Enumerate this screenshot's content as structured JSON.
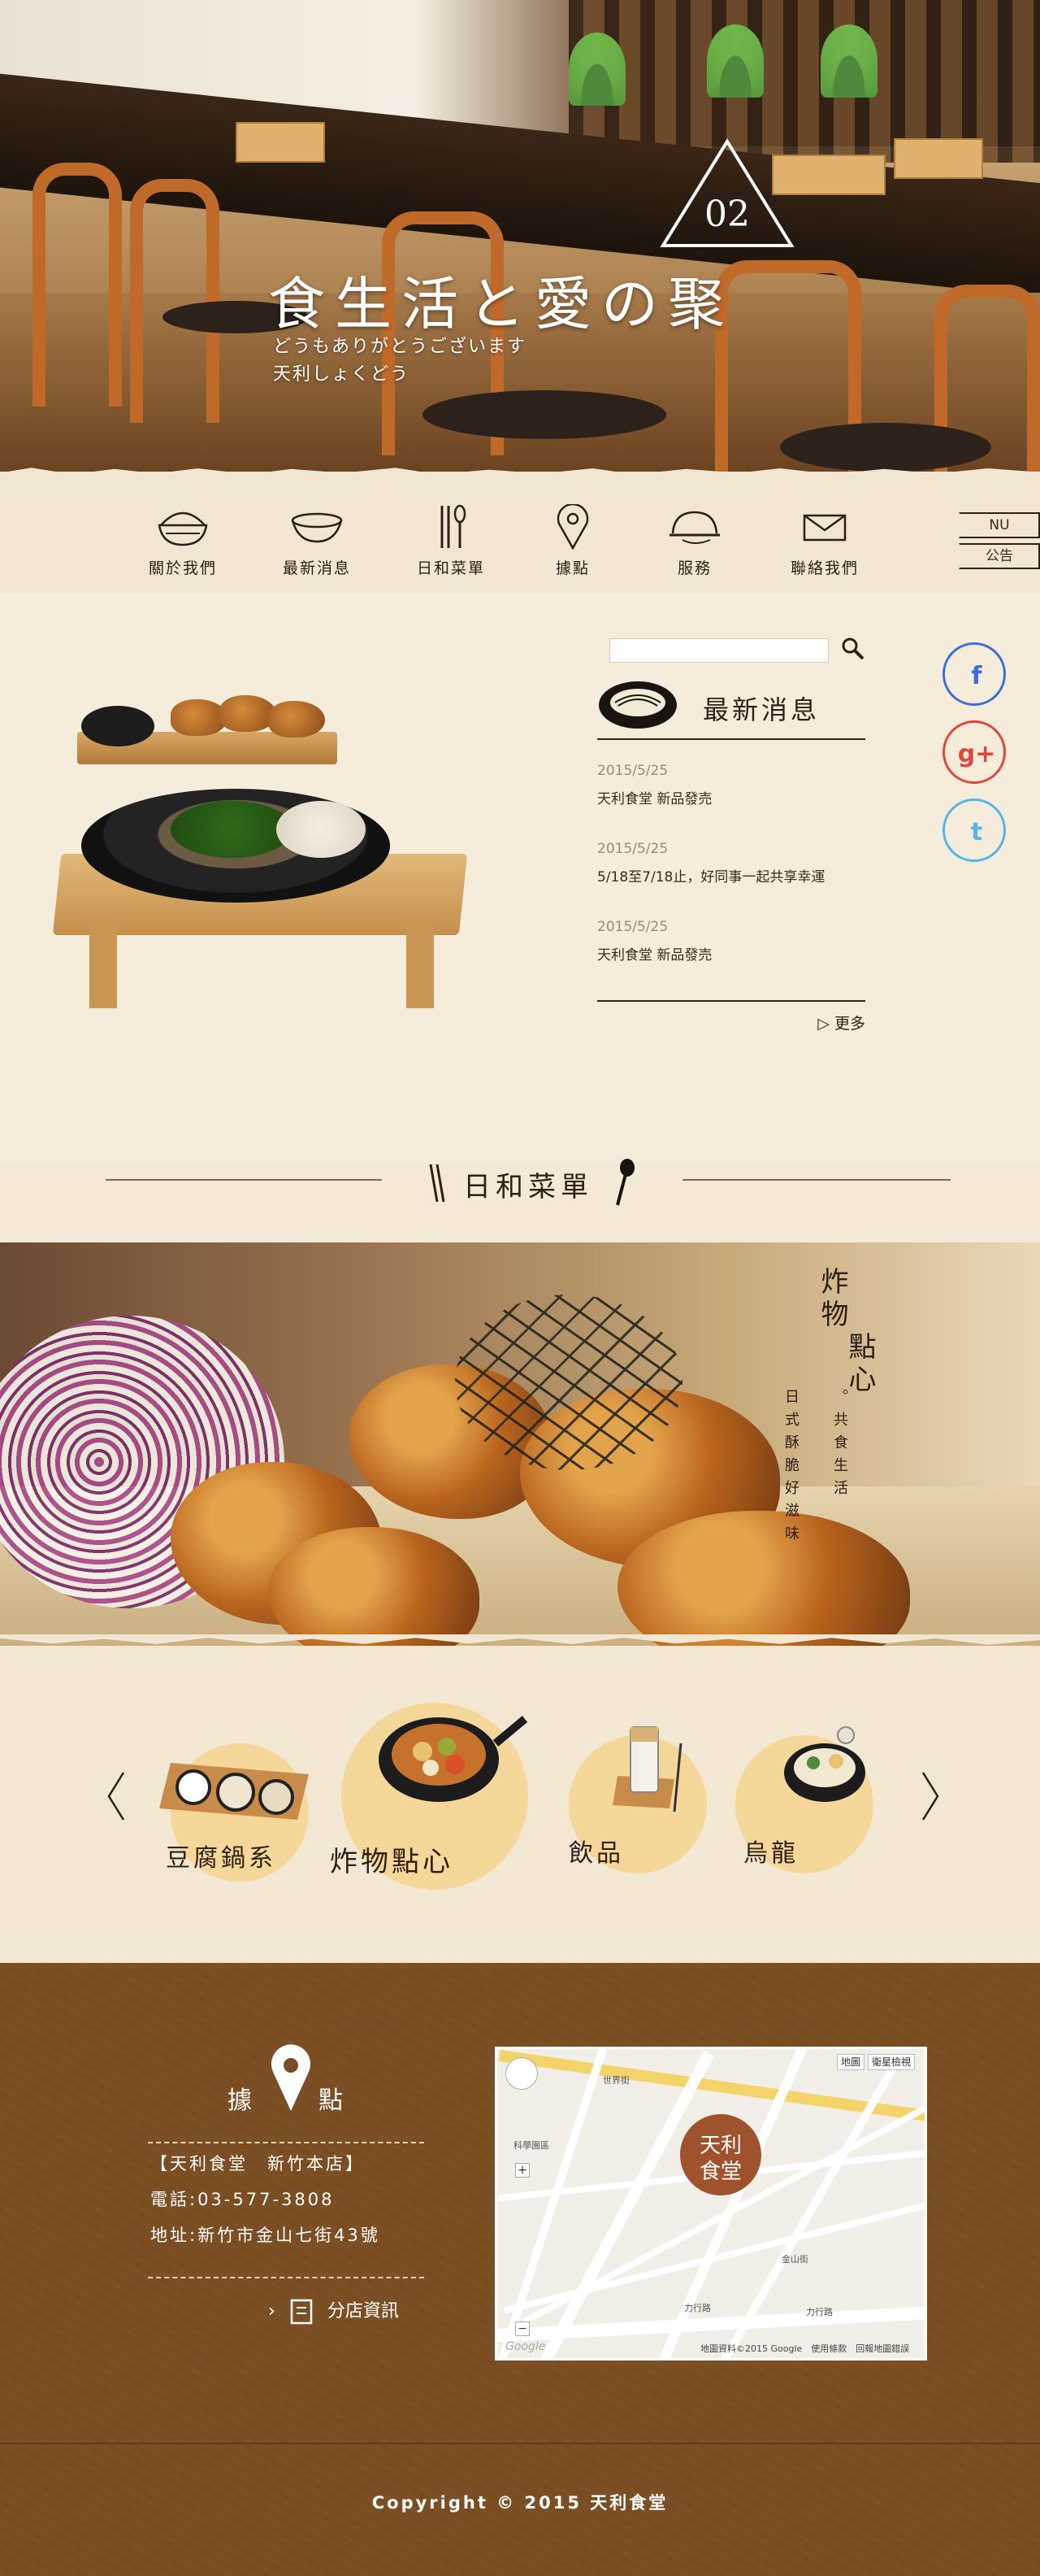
{
  "hero": {
    "badge": "02",
    "title": "食生活と愛の聚",
    "subtitle_line1": "どうもありがとうございます",
    "subtitle_line2": "天利しょくどう"
  },
  "nav": {
    "items": [
      {
        "label": "關於我們",
        "icon": "rice-bowl-icon"
      },
      {
        "label": "最新消息",
        "icon": "bowl-icon"
      },
      {
        "label": "日和菜單",
        "icon": "chopsticks-spoon-icon"
      },
      {
        "label": "據點",
        "icon": "location-pin-icon"
      },
      {
        "label": "服務",
        "icon": "cloche-icon"
      },
      {
        "label": "聯絡我們",
        "icon": "envelope-icon"
      }
    ],
    "notice_line1": "NU",
    "notice_line2": "公告"
  },
  "news": {
    "title": "最新消息",
    "items": [
      {
        "date": "2015/5/25",
        "text": "天利食堂 新品發売"
      },
      {
        "date": "2015/5/25",
        "text": "5/18至7/18止，好同事一起共享幸運"
      },
      {
        "date": "2015/5/25",
        "text": "天利食堂 新品發売"
      }
    ],
    "more": "更多"
  },
  "social": [
    {
      "label": "f",
      "color": "#3b6fd6",
      "icon": "facebook-icon"
    },
    {
      "label": "g+",
      "color": "#e2463b",
      "icon": "googleplus-icon"
    },
    {
      "label": "t",
      "color": "#55b4e9",
      "icon": "twitter-icon"
    }
  ],
  "menu_section": {
    "title": "日和菜單"
  },
  "banner": {
    "title_line1": "炸物",
    "title_line2": "點心",
    "tagline_right": "。共食生活",
    "tagline_left": "日式酥脆好滋味"
  },
  "carousel": {
    "items": [
      {
        "label": "豆腐鍋系"
      },
      {
        "label": "炸物點心"
      },
      {
        "label": "飲品"
      },
      {
        "label": "烏龍"
      }
    ]
  },
  "footer": {
    "locations_title_1": "據",
    "locations_title_2": "點",
    "store_name": "【天利食堂　新竹本店】",
    "phone": "電話:03-577-3808",
    "address": "地址:新竹市金山七街43號",
    "branch_link": "分店資訊",
    "copyright": "Copyright © 2015 天利食堂"
  },
  "map": {
    "badge_line1": "天利",
    "badge_line2": "食堂",
    "type_map": "地圖",
    "type_satellite": "衛星檢視",
    "footer_text": "地圖資料©2015 Google　使用條款　回報地圖錯誤",
    "google_logo": "Google",
    "streets": [
      "力行路",
      "力行路",
      "金山街",
      "科學園區",
      "世界街"
    ],
    "colors": {
      "badge": "#a0522d",
      "highway": "#f4d46a"
    }
  },
  "colors": {
    "footer_bg": "#7a4d22",
    "page_bg": "#f3e9d6",
    "accent": "#f6d79a"
  }
}
